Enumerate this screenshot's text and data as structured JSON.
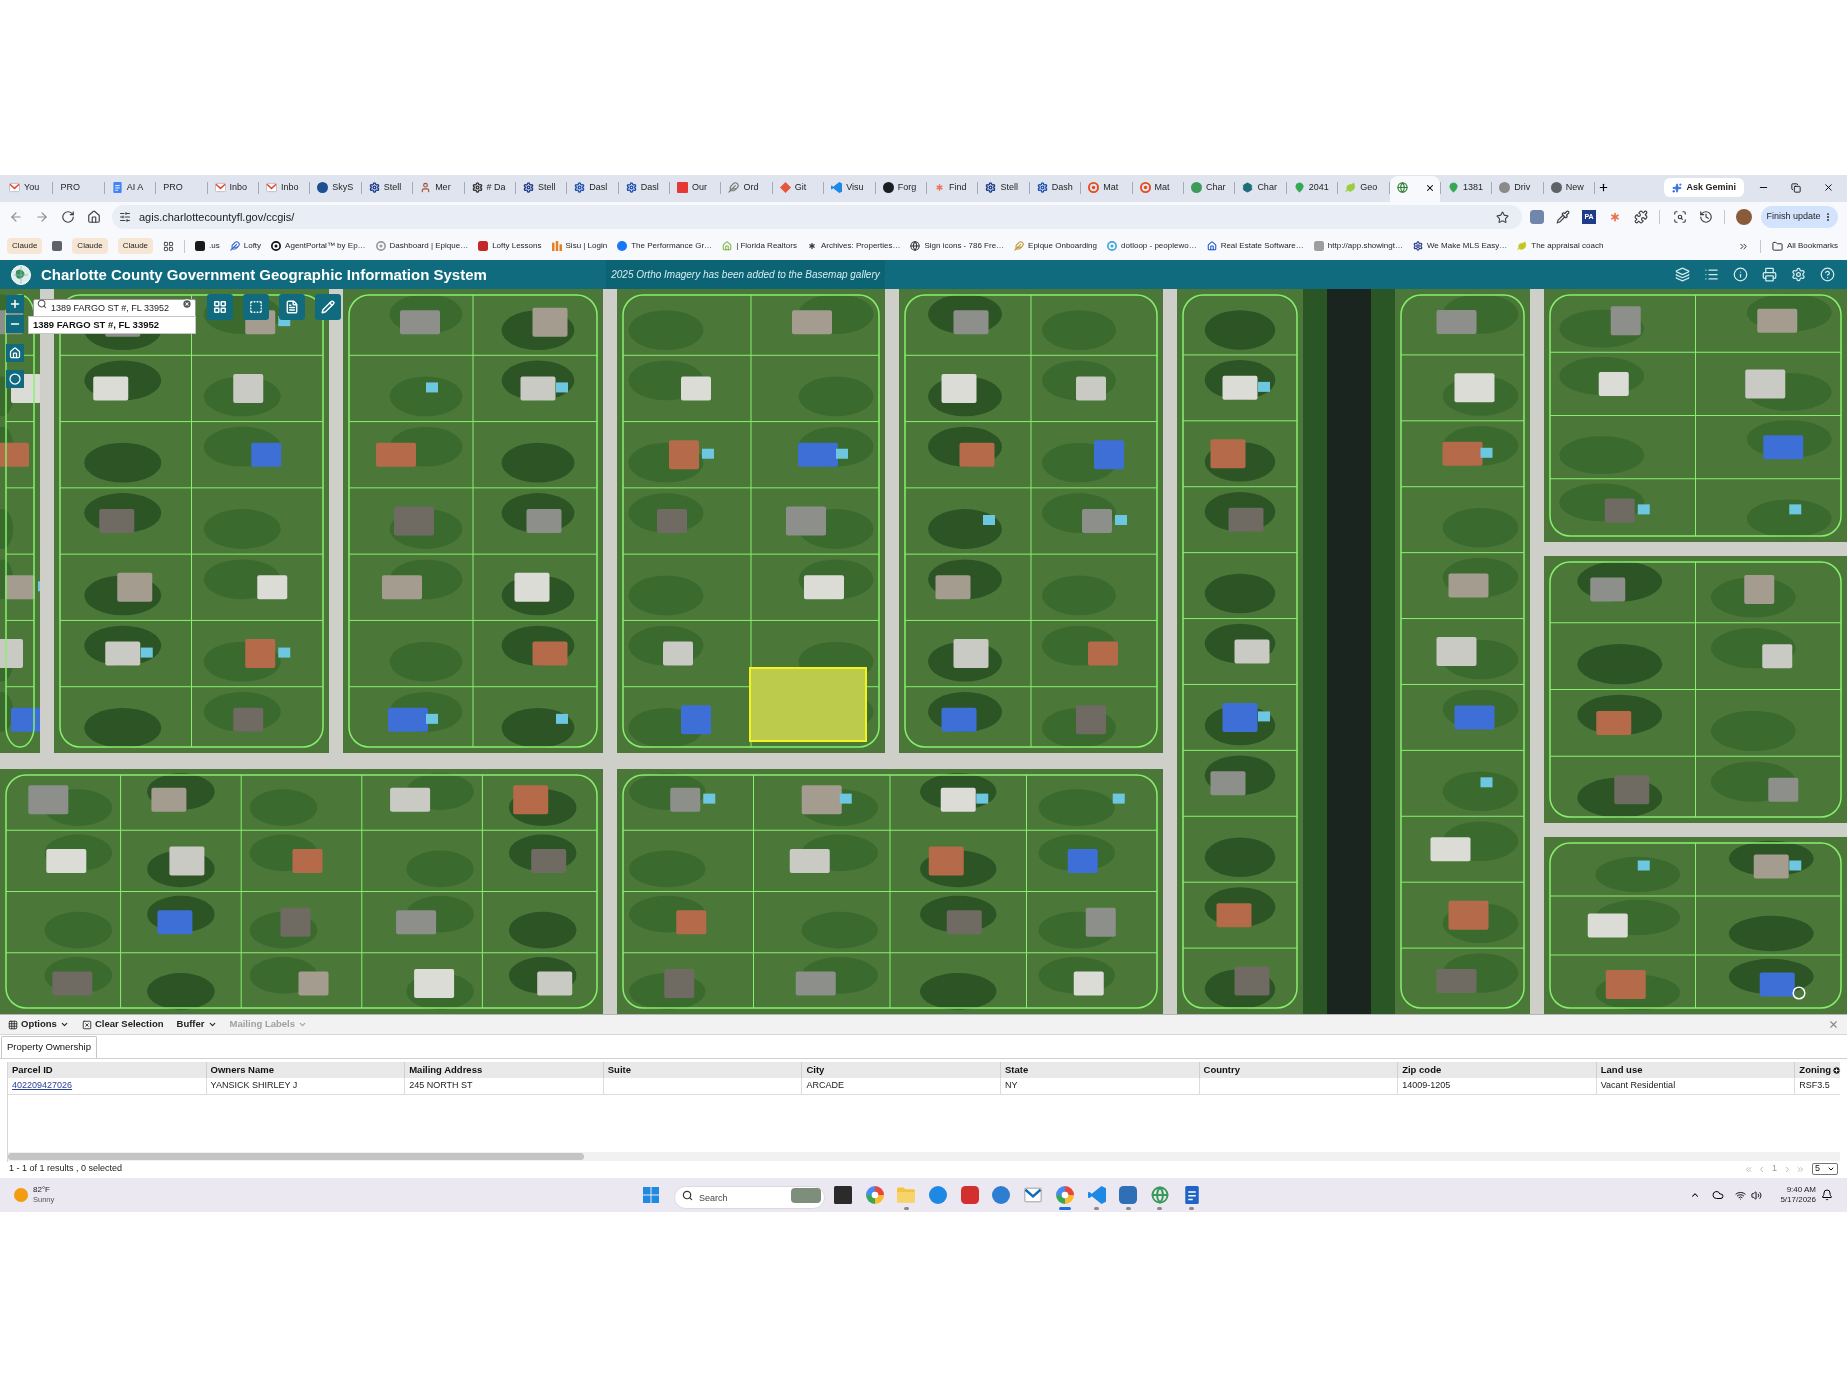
{
  "browser": {
    "tabs": [
      {
        "label": "You",
        "selected": false
      },
      {
        "label": "PRO",
        "selected": false
      },
      {
        "label": "AI A",
        "selected": false
      },
      {
        "label": "PRO",
        "selected": false
      },
      {
        "label": "Inbo",
        "selected": false
      },
      {
        "label": "Inbo",
        "selected": false
      },
      {
        "label": "SkyS",
        "selected": false
      },
      {
        "label": "Stell",
        "selected": false
      },
      {
        "label": "Mer",
        "selected": false
      },
      {
        "label": "# Da",
        "selected": false
      },
      {
        "label": "Stell",
        "selected": false
      },
      {
        "label": "Dasl",
        "selected": false
      },
      {
        "label": "Dasl",
        "selected": false
      },
      {
        "label": "Our",
        "selected": false
      },
      {
        "label": "Ord",
        "selected": false
      },
      {
        "label": "Git",
        "selected": false
      },
      {
        "label": "Visu",
        "selected": false
      },
      {
        "label": "Forg",
        "selected": false
      },
      {
        "label": "Find",
        "selected": false
      },
      {
        "label": "Stell",
        "selected": false
      },
      {
        "label": "Dash",
        "selected": false
      },
      {
        "label": "Mat",
        "selected": false
      },
      {
        "label": "Mat",
        "selected": false
      },
      {
        "label": "Char",
        "selected": false
      },
      {
        "label": "Char",
        "selected": false
      },
      {
        "label": "2041",
        "selected": false
      },
      {
        "label": "Geo",
        "selected": false
      },
      {
        "selected": true
      },
      {
        "label": "1381",
        "selected": false
      },
      {
        "label": "Driv",
        "selected": false
      },
      {
        "label": "New",
        "selected": false
      }
    ],
    "ask_button": "Ask Gemini",
    "url": "agis.charlottecountyfl.gov/ccgis/",
    "extension_badge": "PA",
    "update_button": "Finish update",
    "bookmarks": [
      {
        "kind": "group",
        "label": "Claude",
        "color": "#f6e6d4"
      },
      {
        "kind": "group",
        "color": "#5f6368"
      },
      {
        "kind": "group",
        "label": "Claude",
        "color": "#f6e6d4"
      },
      {
        "kind": "group",
        "label": "Claude",
        "color": "#f6e6d4"
      },
      {
        "kind": "apps"
      },
      {
        "kind": "link",
        "label": ".us"
      },
      {
        "kind": "link",
        "label": "Lofty"
      },
      {
        "kind": "link",
        "label": "AgentPortal™ by Ep…"
      },
      {
        "kind": "link",
        "label": "Dashboard | Epique…"
      },
      {
        "kind": "link",
        "label": "Lofty Lessons"
      },
      {
        "kind": "link",
        "label": "Sisu | Login"
      },
      {
        "kind": "link",
        "label": "The Performance Gr…"
      },
      {
        "kind": "link",
        "label": "| Florida Realtors"
      },
      {
        "kind": "link",
        "label": "Archives: Properties…"
      },
      {
        "kind": "link",
        "label": "Sign icons - 786 Fre…"
      },
      {
        "kind": "link",
        "label": "Epique Onboarding"
      },
      {
        "kind": "link",
        "label": "dotloop - peoplewo…"
      },
      {
        "kind": "link",
        "label": "Real Estate Software…"
      },
      {
        "kind": "link",
        "label": "http://app.showingt…"
      },
      {
        "kind": "link",
        "label": "We Make MLS Easy…"
      },
      {
        "kind": "link",
        "label": "The appraisal coach"
      }
    ],
    "all_bookmarks": "All Bookmarks"
  },
  "header": {
    "title": "Charlotte County Government Geographic Information System",
    "notice": "2025 Ortho Imagery has been added to the Basemap gallery"
  },
  "map": {
    "search": {
      "value": "1389 FARGO ST #, FL 33952"
    },
    "result": "1389 FARGO ST #, FL 33952"
  },
  "panel": {
    "toolbar": [
      {
        "kind": "menu",
        "label": "Options",
        "disabled": false
      },
      {
        "kind": "action",
        "label": "Clear Selection",
        "disabled": false
      },
      {
        "kind": "menu",
        "label": "Buffer",
        "disabled": false
      },
      {
        "kind": "menu",
        "label": "Mailing Labels",
        "disabled": true
      }
    ],
    "tabs": [
      {
        "label": "Property Ownership",
        "selected": true
      }
    ],
    "table": {
      "columns": [
        "Parcel ID",
        "Owners Name",
        "Mailing Address",
        "Suite",
        "City",
        "State",
        "Country",
        "Zip code",
        "Land use",
        "Zoning"
      ],
      "rows": [
        {
          "cells": [
            "402209427026",
            "YANSICK SHIRLEY J",
            "245 NORTH ST",
            null,
            "ARCADE",
            "NY",
            null,
            "14009-1205",
            "Vacant Residential",
            "RSF3.5"
          ]
        }
      ]
    },
    "status": "1 - 1 of 1 results , 0 selected",
    "pagination": {
      "disabled": true,
      "page": "1",
      "page_size": "5"
    }
  },
  "taskbar": {
    "weather": {
      "temperature": "82°F",
      "condition": "Sunny"
    },
    "search": {
      "placeholder": "Search"
    },
    "apps": [
      {
        "running": false,
        "selected": false
      },
      {
        "running": false,
        "selected": false
      },
      {
        "running": true,
        "selected": false
      },
      {
        "running": false,
        "selected": false
      },
      {
        "running": false,
        "selected": false
      },
      {
        "running": false,
        "selected": false
      },
      {
        "running": false,
        "selected": false
      },
      {
        "running": true,
        "selected": true
      },
      {
        "running": true,
        "selected": false
      },
      {
        "running": true,
        "selected": false
      },
      {
        "running": true,
        "selected": false
      },
      {
        "running": true,
        "selected": false
      }
    ],
    "time": "9:40 AM",
    "date": "5/17/2026"
  }
}
